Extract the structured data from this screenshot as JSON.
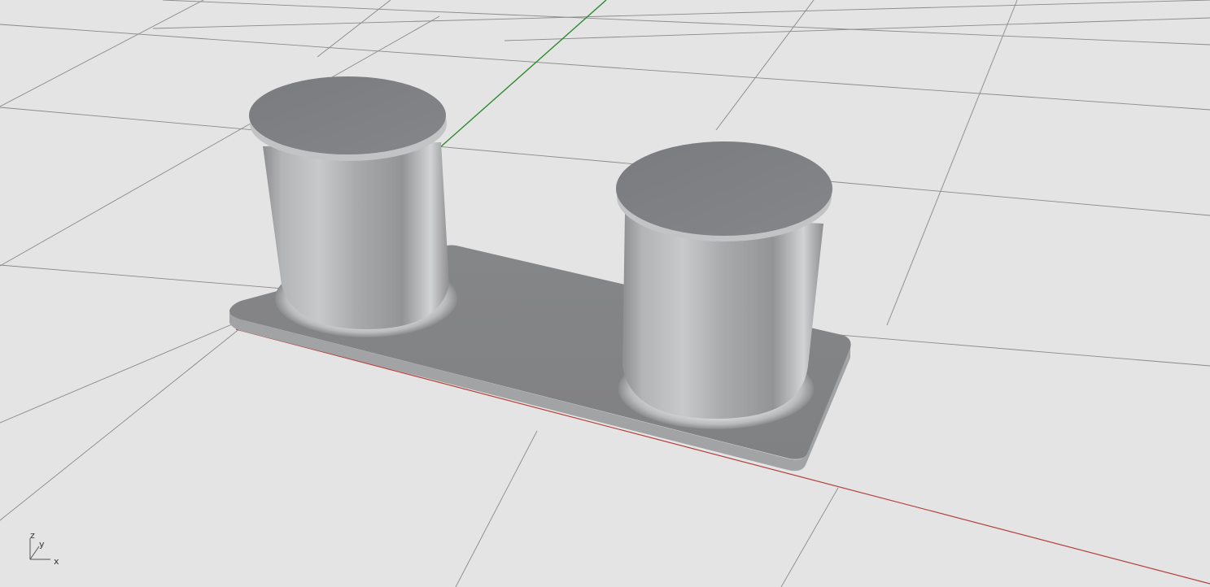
{
  "viewport": {
    "background_color": "#e4e4e4",
    "grid_color": "#8a8a8a",
    "x_axis_color": "#b5403c",
    "y_axis_color": "#2f8a2f",
    "model_color": "#8a8b8d",
    "shading": "rendered",
    "model": "double-bitt-mooring-bollard"
  },
  "axis_gizmo": {
    "z": "z",
    "y": "y",
    "x": "x"
  }
}
